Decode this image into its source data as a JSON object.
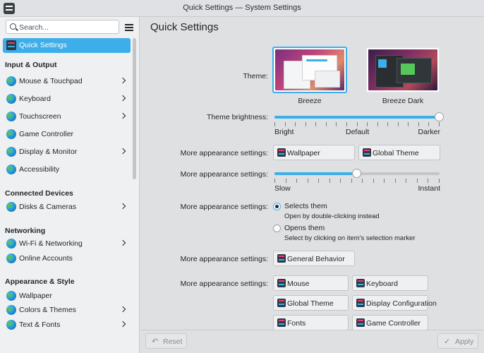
{
  "window": {
    "title": "Quick Settings — System Settings"
  },
  "sidebar": {
    "search_placeholder": "Search...",
    "active_item": {
      "label": "Quick Settings",
      "icon": "quick-settings-icon"
    },
    "sections": [
      {
        "heading": "Input & Output",
        "items": [
          {
            "label": "Mouse & Touchpad",
            "has_children": true
          },
          {
            "label": "Keyboard",
            "has_children": true
          },
          {
            "label": "Touchscreen",
            "has_children": true
          },
          {
            "label": "Game Controller",
            "has_children": false
          },
          {
            "label": "Display & Monitor",
            "has_children": true
          },
          {
            "label": "Accessibility",
            "has_children": false
          }
        ]
      },
      {
        "heading": "Connected Devices",
        "items": [
          {
            "label": "Disks & Cameras",
            "has_children": true
          }
        ]
      },
      {
        "heading": "Networking",
        "items": [
          {
            "label": "Wi-Fi & Networking",
            "has_children": true
          },
          {
            "label": "Online Accounts",
            "has_children": false
          }
        ]
      },
      {
        "heading": "Appearance & Style",
        "items": [
          {
            "label": "Wallpaper",
            "has_children": false
          },
          {
            "label": "Colors & Themes",
            "has_children": true
          },
          {
            "label": "Text & Fonts",
            "has_children": true
          }
        ]
      }
    ]
  },
  "main": {
    "title": "Quick Settings",
    "theme": {
      "label": "Theme:",
      "options": [
        {
          "name": "Breeze",
          "selected": true
        },
        {
          "name": "Breeze Dark",
          "selected": false
        }
      ]
    },
    "brightness": {
      "label": "Theme brightness:",
      "value_fraction": 1.0,
      "left": "Bright",
      "center": "Default",
      "right": "Darker"
    },
    "appearance_buttons": {
      "label": "More appearance settings:",
      "buttons": [
        "Wallpaper",
        "Global Theme"
      ]
    },
    "speed": {
      "label": "More appearance settings:",
      "value_fraction": 0.5,
      "left": "Slow",
      "right": "Instant"
    },
    "click_behavior": {
      "label": "More appearance settings:",
      "options": [
        {
          "title": "Selects them",
          "desc": "Open by double-clicking instead",
          "checked": true
        },
        {
          "title": "Opens them",
          "desc": "Select by clicking on item's selection marker",
          "checked": false
        }
      ]
    },
    "general": {
      "label": "More appearance settings:",
      "button": "General Behavior"
    },
    "more_settings": {
      "label": "More appearance settings:",
      "buttons": [
        "Mouse",
        "Keyboard",
        "Global Theme",
        "Display Configuration",
        "Fonts",
        "Game Controller"
      ]
    }
  },
  "footer": {
    "reset": "Reset",
    "apply": "Apply"
  },
  "colors": {
    "accent": "#3daee9",
    "sidebar_bg": "#eff0f1",
    "main_bg": "#dee0e2"
  }
}
